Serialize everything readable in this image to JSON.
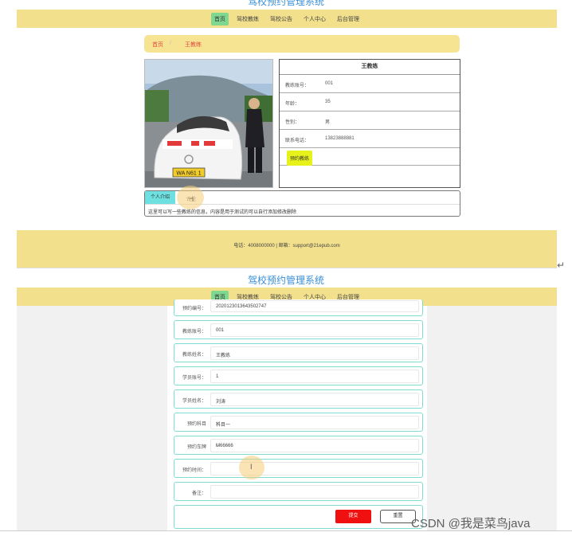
{
  "top_page": {
    "site_title": "驾校预约管理系统",
    "nav": [
      "首页",
      "驾校教练",
      "驾校公告",
      "个人中心",
      "后台管理"
    ],
    "breadcrumb": {
      "home": "首页",
      "separator": "/",
      "current": "王教练"
    },
    "coach_card": {
      "name": "王教练",
      "rows": [
        {
          "label": "教练账号：",
          "value": "001"
        },
        {
          "label": "年龄：",
          "value": "35"
        },
        {
          "label": "性别：",
          "value": "男"
        },
        {
          "label": "联系电话：",
          "value": "13823888881"
        }
      ],
      "book_button": "预约教练"
    },
    "car_plate": "WA N61 1",
    "tabs": {
      "active": "个人介绍",
      "other": "评论"
    },
    "intro_text": "这里可以写一些教练的信息，内容是用于测试的可以自行添加修改删除",
    "footer": "电话：4008000000 | 邮箱：support@21epub.com"
  },
  "bottom_page": {
    "site_title": "驾校预约管理系统",
    "nav": [
      "首页",
      "驾校教练",
      "驾校公告",
      "个人中心",
      "后台管理"
    ],
    "partial_row": {
      "label": "预约编号：",
      "value": "2020123013643502747"
    },
    "fields": [
      {
        "label": "教练账号：",
        "value": "001"
      },
      {
        "label": "教练姓名：",
        "value": "王教练"
      },
      {
        "label": "学员账号：",
        "value": "1"
      },
      {
        "label": "学员姓名：",
        "value": "刘涛"
      },
      {
        "label": "预约科目",
        "value": "科目一",
        "select": true
      },
      {
        "label": "预约车牌",
        "value": "M66666",
        "select": true
      },
      {
        "label": "预约时间：",
        "value": ""
      },
      {
        "label": "备注：",
        "value": ""
      }
    ],
    "submit": "提交",
    "reset": "重置"
  },
  "watermark": "CSDN @我是菜鸟java",
  "colors": {
    "nav_bg": "#f2e08c",
    "active_nav": "#7fd890",
    "title_blue": "#3a8fd8",
    "submit_red": "#f01010",
    "book_yellow": "#e6f21a",
    "tab_cyan": "#6fe0e0"
  }
}
